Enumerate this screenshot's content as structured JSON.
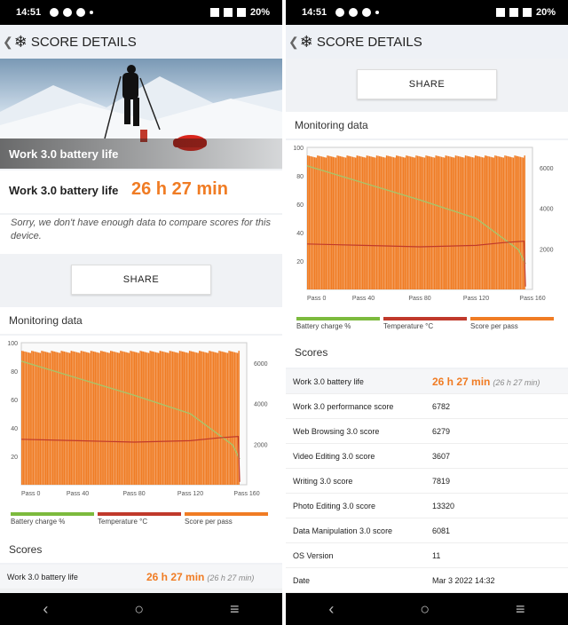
{
  "status": {
    "time": "14:51",
    "battery": "20%"
  },
  "appbar": {
    "title": "SCORE DETAILS"
  },
  "hero": {
    "caption": "Work 3.0 battery life"
  },
  "summary": {
    "label": "Work 3.0 battery life",
    "value": "26 h 27 min",
    "sorry": "Sorry, we don't have enough data to compare scores for this device."
  },
  "share_label": "SHARE",
  "monitoring_title": "Monitoring data",
  "scores_title": "Scores",
  "legend": [
    {
      "label": "Battery charge %",
      "color": "#7cba3d"
    },
    {
      "label": "Temperature °C",
      "color": "#c0392b"
    },
    {
      "label": "Score per pass",
      "color": "#f07c24"
    }
  ],
  "chart_data": {
    "type": "bar",
    "x_tick_labels": [
      "Pass 0",
      "Pass 40",
      "Pass 80",
      "Pass 120",
      "Pass 160"
    ],
    "left_axis_ticks": [
      "100",
      "80",
      "60",
      "40",
      "20"
    ],
    "right_axis_ticks": [
      "6000",
      "4000",
      "2000"
    ],
    "ylim_left": [
      0,
      100
    ],
    "ylim_right": [
      0,
      7000
    ],
    "xlim": [
      0,
      160
    ],
    "series": [
      {
        "name": "Score per pass",
        "axis": "right",
        "approx_value": 6600
      },
      {
        "name": "Battery charge %",
        "axis": "left",
        "points": [
          [
            0,
            87
          ],
          [
            40,
            75
          ],
          [
            80,
            63
          ],
          [
            120,
            50
          ],
          [
            150,
            28
          ],
          [
            155,
            18
          ]
        ]
      },
      {
        "name": "Temperature °C",
        "axis": "left",
        "points": [
          [
            0,
            32
          ],
          [
            40,
            31
          ],
          [
            80,
            30
          ],
          [
            120,
            31
          ],
          [
            140,
            33
          ],
          [
            154,
            34
          ],
          [
            155,
            2
          ]
        ]
      }
    ]
  },
  "scores": [
    {
      "label": "Work 3.0 battery life",
      "value": "26 h 27 min",
      "sub": "(26 h 27 min)"
    },
    {
      "label": "Work 3.0 performance score",
      "value": "6782"
    },
    {
      "label": "Web Browsing 3.0 score",
      "value": "6279"
    },
    {
      "label": "Video Editing 3.0 score",
      "value": "3607"
    },
    {
      "label": "Writing 3.0 score",
      "value": "7819"
    },
    {
      "label": "Photo Editing 3.0 score",
      "value": "13320"
    },
    {
      "label": "Data Manipulation 3.0 score",
      "value": "6081"
    },
    {
      "label": "OS Version",
      "value": "11"
    },
    {
      "label": "Date",
      "value": "Mar 3 2022 14:32"
    }
  ]
}
